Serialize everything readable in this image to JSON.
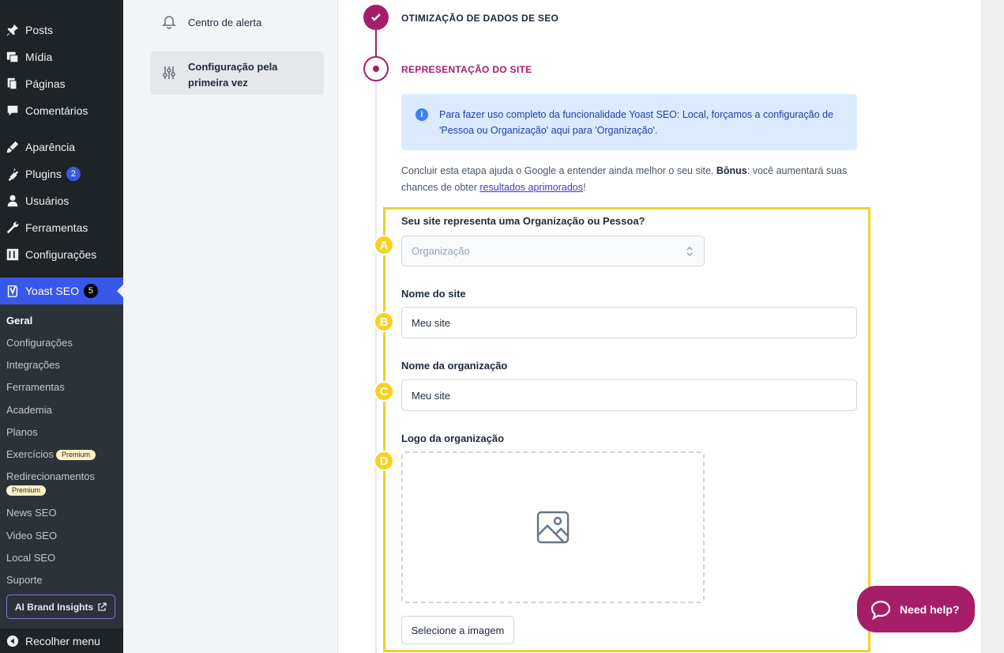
{
  "wp_menu": {
    "items": [
      {
        "label": "Posts",
        "icon": "pin-icon"
      },
      {
        "label": "Mídia",
        "icon": "media-icon"
      },
      {
        "label": "Páginas",
        "icon": "pages-icon"
      },
      {
        "label": "Comentários",
        "icon": "comments-icon"
      },
      {
        "label": "Aparência",
        "icon": "appearance-icon"
      },
      {
        "label": "Plugins",
        "icon": "plugins-icon",
        "badge": "2"
      },
      {
        "label": "Usuários",
        "icon": "users-icon"
      },
      {
        "label": "Ferramentas",
        "icon": "tools-icon"
      },
      {
        "label": "Configurações",
        "icon": "settings-icon"
      }
    ],
    "yoast": {
      "label": "Yoast SEO",
      "badge": "5"
    },
    "submenu": [
      "Geral",
      "Configurações",
      "Integrações",
      "Ferramentas",
      "Academia",
      "Planos",
      "Exercícios",
      "Redirecionamentos",
      "News SEO",
      "Video SEO",
      "Local SEO",
      "Suporte"
    ],
    "premium_label": "Premium",
    "ai_button": "AI Brand Insights",
    "collapse": "Recolher menu"
  },
  "yoast_nav": {
    "alert_center": "Centro de alerta",
    "first_config": "Configuração pela primeira vez"
  },
  "steps": {
    "step1": "OTIMIZAÇÃO DE DADOS DE SEO",
    "step2": "REPRESENTAÇÃO DO SITE"
  },
  "info": {
    "text": "Para fazer uso completo da funcionalidade Yoast SEO: Local, forçamos a configuração de 'Pessoa ou Organização' aqui para 'Organização'."
  },
  "intro": {
    "part1": "Concluir esta etapa ajuda o Google a entender ainda melhor o seu site. ",
    "bold": "Bônus",
    "part2": ": você aumentará suas chances de obter ",
    "link": "resultados aprimorados",
    "part3": "!"
  },
  "form": {
    "type_label": "Seu site representa uma Organização ou Pessoa?",
    "type_value": "Organização",
    "site_name_label": "Nome do site",
    "site_name_value": "Meu site",
    "org_name_label": "Nome da organização",
    "org_name_value": "Meu site",
    "logo_label": "Logo da organização",
    "select_image": "Selecione a imagem"
  },
  "markers": [
    "A",
    "B",
    "C",
    "D"
  ],
  "help": "Need help?",
  "colors": {
    "yoast_primary": "#a61e69",
    "wp_accent": "#3858e9",
    "highlight": "#f2d02a"
  }
}
